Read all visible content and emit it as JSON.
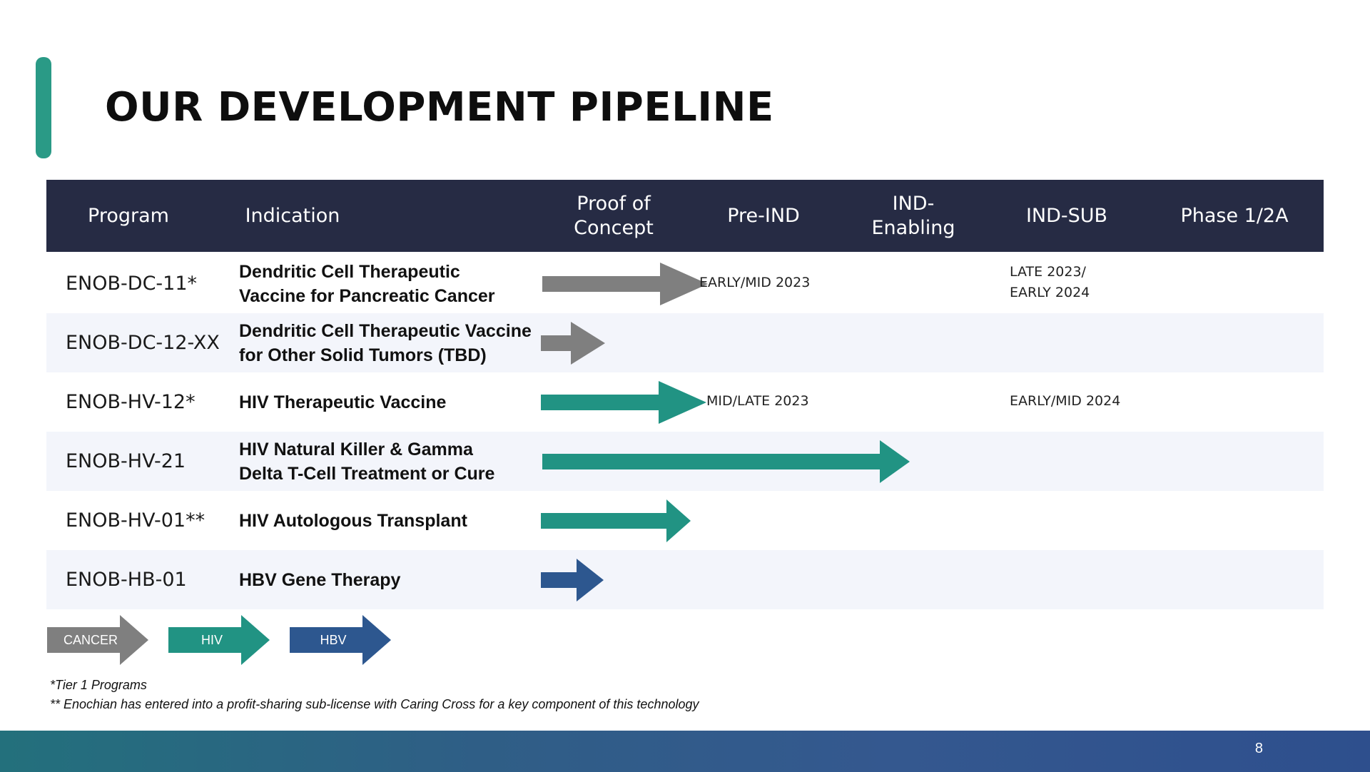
{
  "title": "OUR DEVELOPMENT PIPELINE",
  "colors": {
    "accent": "#2a9a86",
    "header_bg": "#262b44",
    "cancer": "#7f7f7f",
    "hiv": "#219383",
    "hbv": "#2d578f"
  },
  "columns": {
    "program": "Program",
    "indication": "Indication",
    "proof_line1": "Proof of",
    "proof_line2": "Concept",
    "pre_ind": "Pre-IND",
    "ind_enabling_line1": "IND-",
    "ind_enabling_line2": "Enabling",
    "ind_sub": "IND-SUB",
    "phase": "Phase 1/2A"
  },
  "rows": [
    {
      "program": "ENOB-DC-11*",
      "indication_line1": "Dendritic Cell Therapeutic",
      "indication_line2": "Vaccine for Pancreatic Cancer",
      "category": "CANCER",
      "progress_stage": "Proof of Concept",
      "pre_ind_note": "EARLY/MID 2023",
      "ind_sub_note_line1": "LATE 2023/",
      "ind_sub_note_line2": "EARLY 2024"
    },
    {
      "program": "ENOB-DC-12-XX",
      "indication_line1": "Dendritic Cell Therapeutic Vaccine",
      "indication_line2": "for Other Solid Tumors (TBD)",
      "category": "CANCER",
      "progress_stage": "Proof of Concept"
    },
    {
      "program": "ENOB-HV-12*",
      "indication_line1": "HIV Therapeutic Vaccine",
      "category": "HIV",
      "progress_stage": "Proof of Concept",
      "pre_ind_note": "MID/LATE 2023",
      "ind_sub_note_line1": "EARLY/MID 2024"
    },
    {
      "program": "ENOB-HV-21",
      "indication_line1": "HIV Natural Killer & Gamma",
      "indication_line2": "Delta T-Cell Treatment or Cure",
      "category": "HIV",
      "progress_stage": "IND-Enabling"
    },
    {
      "program": "ENOB-HV-01**",
      "indication_line1": "HIV Autologous Transplant",
      "category": "HIV",
      "progress_stage": "Proof of Concept"
    },
    {
      "program": "ENOB-HB-01",
      "indication_line1": "HBV Gene Therapy",
      "category": "HBV",
      "progress_stage": "Proof of Concept"
    }
  ],
  "legend": [
    {
      "label": "CANCER",
      "color": "#7f7f7f"
    },
    {
      "label": "HIV",
      "color": "#219383"
    },
    {
      "label": "HBV",
      "color": "#2d578f"
    }
  ],
  "footnotes": {
    "note1": "*Tier 1 Programs",
    "note2": "** Enochian has entered into a profit-sharing sub-license with Caring Cross for a key component of this technology"
  },
  "page_number": "8"
}
